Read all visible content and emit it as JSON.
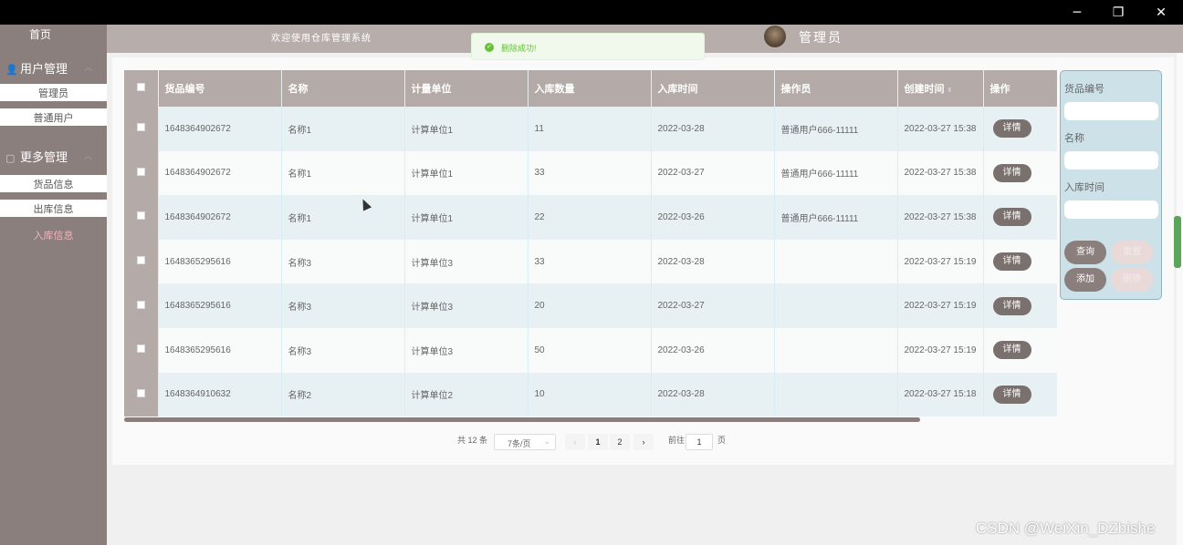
{
  "window": {
    "minimize_icon": "minimize-icon",
    "maximize_icon": "restore-icon",
    "close_icon": "close-icon",
    "minimize": "─",
    "restore": "❐",
    "close": "✕"
  },
  "sidebar": {
    "home": "首页",
    "groups": [
      {
        "label": "用户管理",
        "icon": "user-icon",
        "items": [
          "管理员",
          "普通用户"
        ]
      },
      {
        "label": "更多管理",
        "icon": "folder-icon",
        "items": [
          "货品信息",
          "出库信息",
          "入库信息"
        ]
      }
    ],
    "active_item": "入库信息"
  },
  "header": {
    "welcome": "欢迎使用仓库管理系统",
    "user": "管理员"
  },
  "toast": {
    "message": "删除成功!"
  },
  "table": {
    "columns": [
      "货品编号",
      "名称",
      "计量单位",
      "入库数量",
      "入库时间",
      "操作员",
      "创建时间",
      "操作"
    ],
    "rows": [
      [
        "1648364902672",
        "名称1",
        "计算单位1",
        "11",
        "2022-03-28",
        "普通用户666-11111",
        "2022-03-27 15:38"
      ],
      [
        "1648364902672",
        "名称1",
        "计算单位1",
        "33",
        "2022-03-27",
        "普通用户666-11111",
        "2022-03-27 15:38"
      ],
      [
        "1648364902672",
        "名称1",
        "计算单位1",
        "22",
        "2022-03-26",
        "普通用户666-11111",
        "2022-03-27 15:38"
      ],
      [
        "1648365295616",
        "名称3",
        "计算单位3",
        "33",
        "2022-03-28",
        "",
        "2022-03-27 15:19"
      ],
      [
        "1648365295616",
        "名称3",
        "计算单位3",
        "20",
        "2022-03-27",
        "",
        "2022-03-27 15:19"
      ],
      [
        "1648365295616",
        "名称3",
        "计算单位3",
        "50",
        "2022-03-26",
        "",
        "2022-03-27 15:19"
      ],
      [
        "1648364910632",
        "名称2",
        "计算单位2",
        "10",
        "2022-03-28",
        "",
        "2022-03-27 15:18"
      ]
    ],
    "detail_label": "详情",
    "sort_icon": "⇕"
  },
  "pagination": {
    "total": "共 12 条",
    "page_size": "7条/页",
    "pages": [
      "1",
      "2"
    ],
    "prev": "‹",
    "next": "›",
    "goto_prefix": "前往",
    "goto_value": "1",
    "goto_suffix": "页"
  },
  "search": {
    "fields": [
      "货品编号",
      "名称",
      "入库时间"
    ],
    "buttons": {
      "query": "查询",
      "reset": "重置",
      "add": "添加",
      "delete": "删除"
    }
  },
  "watermark": "CSDN @WeiXin_DZbishe"
}
